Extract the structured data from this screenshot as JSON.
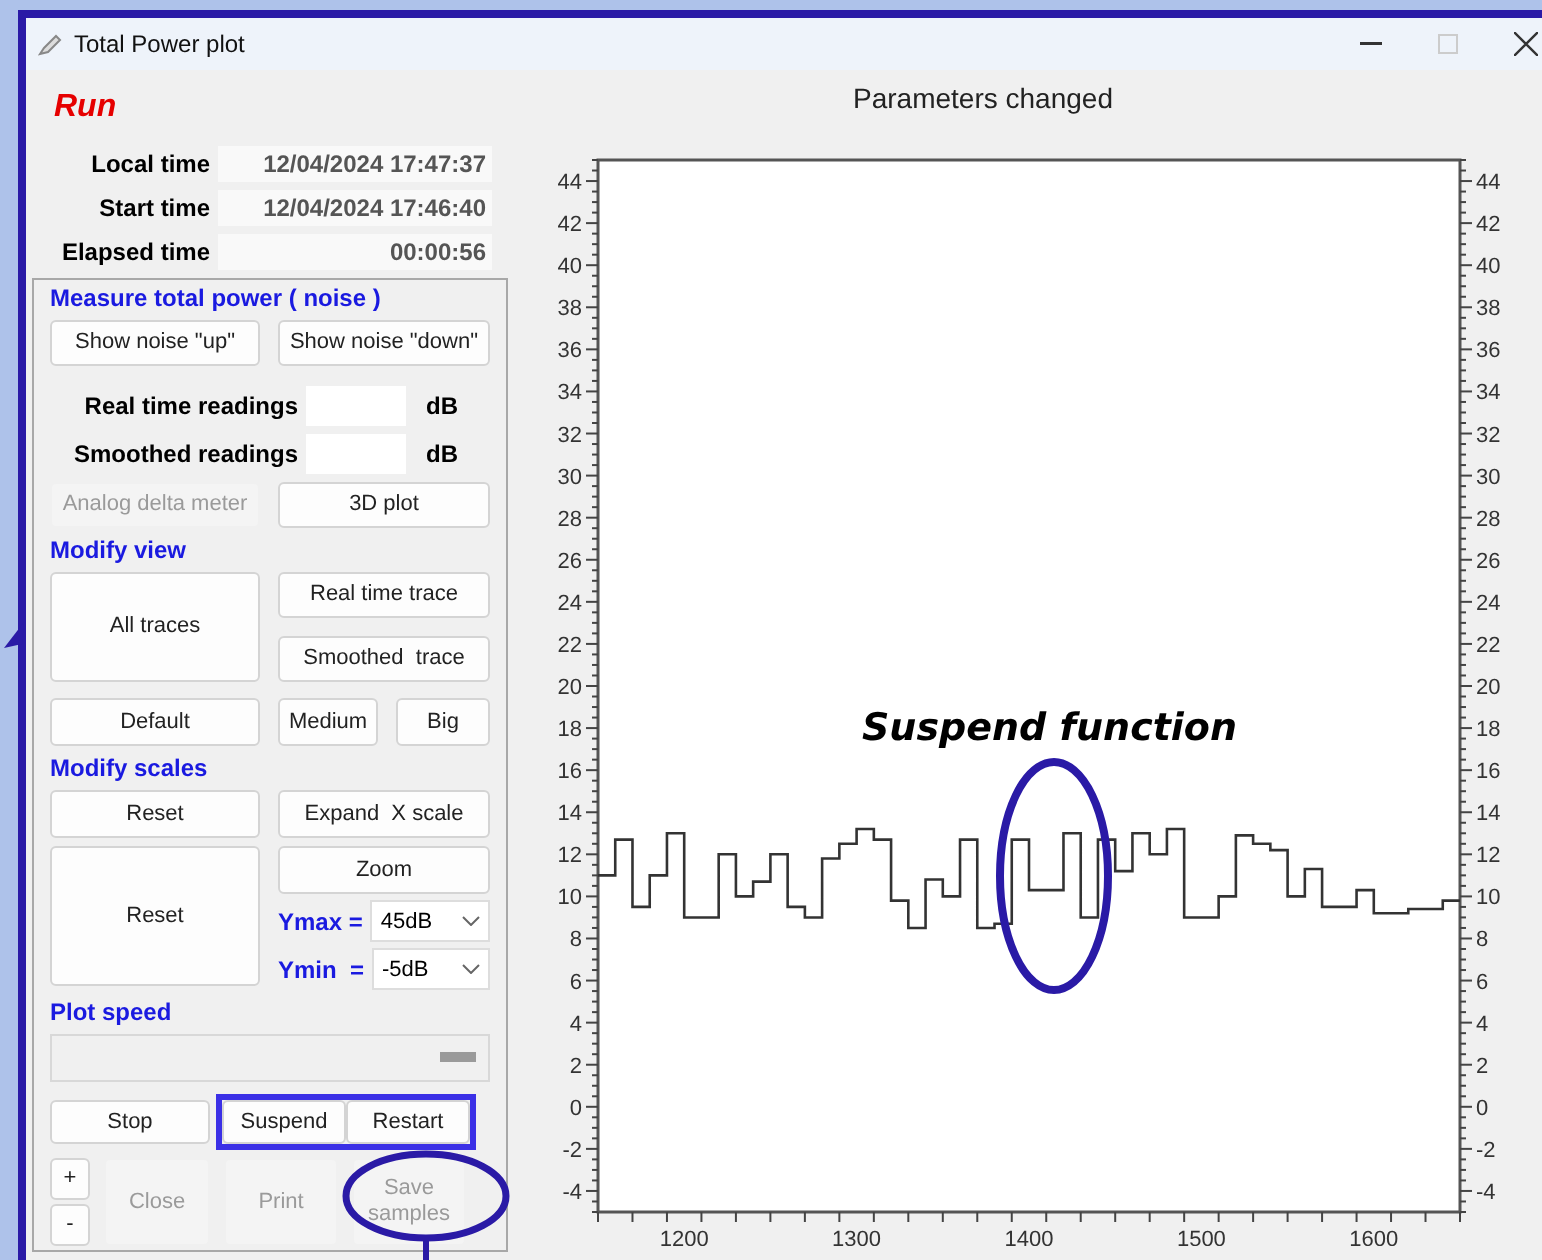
{
  "window": {
    "title": "Total Power plot"
  },
  "status": "Run",
  "times": [
    {
      "label": "Local time",
      "value": "12/04/2024 17:47:37"
    },
    {
      "label": "Start time",
      "value": "12/04/2024 17:46:40"
    },
    {
      "label": "Elapsed time",
      "value": "00:00:56"
    }
  ],
  "measure": {
    "heading": "Measure total power ( noise )",
    "buttons": [
      {
        "label": "Show noise \"up\"",
        "disabled": false
      },
      {
        "label": "Show noise \"down\"",
        "disabled": false
      }
    ],
    "readings": [
      {
        "label": "Real time readings",
        "unit": "dB"
      },
      {
        "label": "Smoothed readings",
        "unit": "dB"
      }
    ],
    "more_buttons": [
      {
        "label": "Analog delta meter",
        "disabled": true
      },
      {
        "label": "3D plot",
        "disabled": false
      }
    ]
  },
  "modify_view": {
    "heading": "Modify view",
    "buttons": [
      {
        "label": "All traces",
        "disabled": false
      },
      {
        "label": "Real time trace",
        "disabled": false
      },
      {
        "label": "Smoothed  trace",
        "disabled": false
      },
      {
        "label": "Default",
        "disabled": false
      },
      {
        "label": "Medium",
        "disabled": false
      },
      {
        "label": "Big",
        "disabled": false
      }
    ]
  },
  "modify_scales": {
    "heading": "Modify scales",
    "buttons": [
      {
        "label": "Reset",
        "disabled": false
      },
      {
        "label": "Expand  X scale",
        "disabled": false
      },
      {
        "label": "Zoom",
        "disabled": false
      },
      {
        "label": "Reset",
        "disabled": false
      }
    ],
    "selects": [
      {
        "label": "Ymax =",
        "value": "45dB"
      },
      {
        "label": "Ymin  =",
        "value": "-5dB"
      }
    ]
  },
  "plot_speed": {
    "heading": "Plot speed",
    "level": 0.93
  },
  "controls": [
    {
      "label": "Stop",
      "disabled": false
    },
    {
      "label": "Suspend",
      "disabled": false
    },
    {
      "label": "Restart",
      "disabled": false
    }
  ],
  "controls_highlighted": true,
  "bottom_buttons": [
    {
      "label": "+",
      "disabled": false
    },
    {
      "label": "-",
      "disabled": false
    },
    {
      "label": "Close",
      "disabled": true
    },
    {
      "label": "Print",
      "disabled": true
    },
    {
      "label": "Save samples",
      "disabled": true
    }
  ],
  "chart": {
    "chart_data": {
      "type": "line",
      "title": "Parameters changed",
      "x": [
        1150,
        1160,
        1160,
        1170,
        1170,
        1180,
        1180,
        1190,
        1190,
        1200,
        1200,
        1220,
        1220,
        1230,
        1230,
        1240,
        1240,
        1250,
        1250,
        1260,
        1260,
        1270,
        1270,
        1280,
        1280,
        1290,
        1290,
        1300,
        1300,
        1310,
        1310,
        1320,
        1320,
        1330,
        1330,
        1340,
        1340,
        1350,
        1350,
        1360,
        1360,
        1370,
        1370,
        1380,
        1380,
        1390,
        1390,
        1400,
        1400,
        1420,
        1420,
        1430,
        1430,
        1440,
        1440,
        1450,
        1450,
        1460,
        1460,
        1470,
        1470,
        1480,
        1480,
        1490,
        1490,
        1510,
        1510,
        1520,
        1520,
        1530,
        1530,
        1540,
        1540,
        1550,
        1550,
        1560,
        1560,
        1570,
        1570,
        1590,
        1590,
        1600,
        1600,
        1620,
        1620,
        1640,
        1640,
        1650
      ],
      "series": [
        {
          "color": "#333333",
          "values": [
            11,
            11,
            12.7,
            12.7,
            9.5,
            9.5,
            11,
            11,
            13,
            13,
            9,
            9,
            12,
            12,
            10,
            10,
            10.7,
            10.7,
            12,
            12,
            9.5,
            9.5,
            9,
            9,
            11.8,
            11.8,
            12.5,
            12.5,
            13.2,
            13.2,
            12.7,
            12.7,
            9.8,
            9.8,
            8.5,
            8.5,
            10.8,
            10.8,
            10,
            10,
            12.7,
            12.7,
            8.5,
            8.5,
            8.7,
            8.7,
            12.7,
            12.7,
            10.3,
            10.3,
            13,
            13,
            9,
            9,
            12.7,
            12.7,
            11.2,
            11.2,
            13,
            13,
            12,
            12,
            13.2,
            13.2,
            9,
            9,
            10,
            10,
            12.9,
            12.9,
            12.5,
            12.5,
            12.2,
            12.2,
            10,
            10,
            11.3,
            11.3,
            9.5,
            9.5,
            10.3,
            10.3,
            9.2,
            9.2,
            9.4,
            9.4,
            9.8,
            9.8
          ]
        }
      ],
      "xlim": [
        1150,
        1650
      ],
      "ylim": [
        -5,
        45
      ],
      "xticks": [
        1200,
        1300,
        1400,
        1500,
        1600
      ],
      "yticks": [
        -4,
        -2,
        0,
        2,
        4,
        6,
        8,
        10,
        12,
        14,
        16,
        18,
        20,
        22,
        24,
        26,
        28,
        30,
        32,
        34,
        36,
        38,
        40,
        42,
        44
      ]
    },
    "right_axis_labels": [
      "44",
      "42",
      "40",
      "38",
      "36",
      "34",
      "32",
      "30",
      "28",
      "26",
      "24",
      "22",
      "20",
      "18",
      "16",
      "14",
      "12",
      "10",
      "8",
      "6",
      "4",
      "2",
      "0",
      "-2",
      "-4"
    ]
  },
  "annotation": {
    "text": "Suspend function"
  }
}
